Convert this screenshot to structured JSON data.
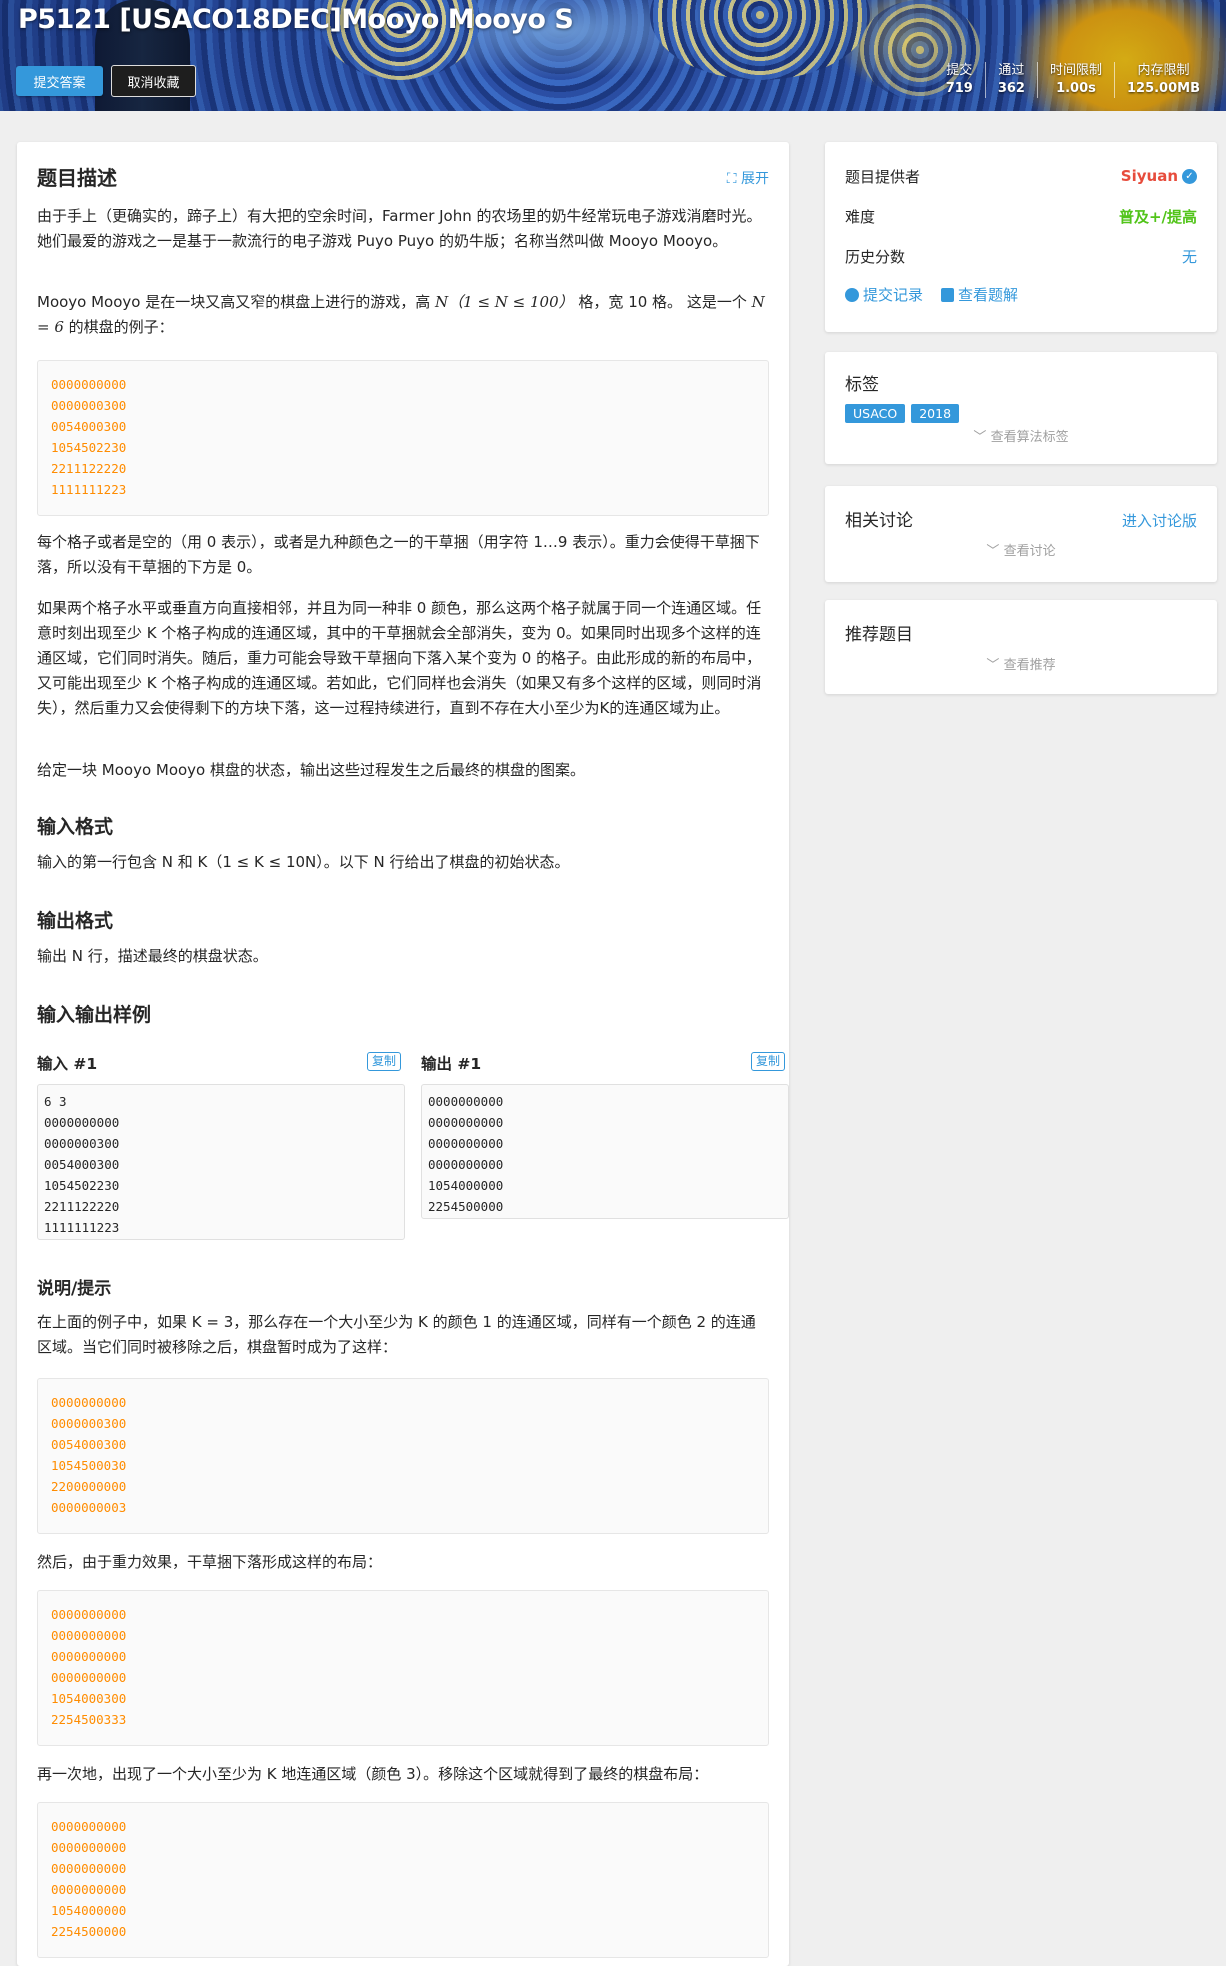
{
  "header": {
    "title": "P5121 [USACO18DEC]Mooyo Mooyo S",
    "submit_label": "提交答案",
    "unfav_label": "取消收藏",
    "stats": [
      {
        "label": "提交",
        "value": "719"
      },
      {
        "label": "通过",
        "value": "362"
      },
      {
        "label": "时间限制",
        "value": "1.00s"
      },
      {
        "label": "内存限制",
        "value": "125.00MB"
      }
    ]
  },
  "main": {
    "desc_title": "题目描述",
    "expand_label": "展开",
    "p1": "由于手上（更确实的，蹄子上）有大把的空余时间，Farmer John 的农场里的奶牛经常玩电子游戏消磨时光。她们最爱的游戏之一是基于一款流行的电子游戏 Puyo Puyo 的奶牛版；名称当然叫做 Mooyo Mooyo。",
    "p2a": "Mooyo Mooyo 是在一块又高又窄的棋盘上进行的游戏，高 ",
    "p2b": "N（1 ≤ N ≤ 100）",
    "p2c": " 格，宽 10 格。 这是一个 ",
    "p2d": "N = 6",
    "p2e": " 的棋盘的例子：",
    "board1": [
      "0000000000",
      "0000000300",
      "0054000300",
      "1054502230",
      "2211122220",
      "1111111223"
    ],
    "p3": "每个格子或者是空的（用 0 表示），或者是九种颜色之一的干草捆（用字符 1…9 表示）。重力会使得干草捆下落，所以没有干草捆的下方是 0。",
    "p4": "如果两个格子水平或垂直方向直接相邻，并且为同一种非 0 颜色，那么这两个格子就属于同一个连通区域。任意时刻出现至少 K 个格子构成的连通区域，其中的干草捆就会全部消失，变为 0。如果同时出现多个这样的连通区域，它们同时消失。随后，重力可能会导致干草捆向下落入某个变为 0 的格子。由此形成的新的布局中，又可能出现至少 K 个格子构成的连通区域。若如此，它们同样也会消失（如果又有多个这样的区域，则同时消失），然后重力又会使得剩下的方块下落，这一过程持续进行，直到不存在大小至少为K的连通区域为止。",
    "p5": "给定一块 Mooyo Mooyo 棋盘的状态，输出这些过程发生之后最终的棋盘的图案。",
    "input_title": "输入格式",
    "input_text": "输入的第一行包含 N 和 K（1 ≤ K ≤ 10N）。以下 N 行给出了棋盘的初始状态。",
    "output_title": "输出格式",
    "output_text": "输出 N 行，描述最终的棋盘状态。",
    "samples_title": "输入输出样例",
    "input_label": "输入 #1",
    "output_label": "输出 #1",
    "copy_label": "复制",
    "sample_input": [
      "6 3",
      "0000000000",
      "0000000300",
      "0054000300",
      "1054502230",
      "2211122220",
      "1111111223"
    ],
    "sample_output": [
      "0000000000",
      "0000000000",
      "0000000000",
      "0000000000",
      "1054000000",
      "2254500000"
    ],
    "hint_title": "说明/提示",
    "hint_p1": "在上面的例子中，如果 K = 3，那么存在一个大小至少为 K 的颜色 1 的连通区域，同样有一个颜色 2 的连通区域。当它们同时被移除之后，棋盘暂时成为了这样：",
    "board2": [
      "0000000000",
      "0000000300",
      "0054000300",
      "1054500030",
      "2200000000",
      "0000000003"
    ],
    "hint_p2": "然后，由于重力效果，干草捆下落形成这样的布局：",
    "board3": [
      "0000000000",
      "0000000000",
      "0000000000",
      "0000000000",
      "1054000300",
      "2254500333"
    ],
    "hint_p3": "再一次地，出现了一个大小至少为 K 地连通区域（颜色 3）。移除这个区域就得到了最终的棋盘布局：",
    "board4": [
      "0000000000",
      "0000000000",
      "0000000000",
      "0000000000",
      "1054000000",
      "2254500000"
    ]
  },
  "sidebar": {
    "provider_label": "题目提供者",
    "provider": "Siyuan",
    "difficulty_label": "难度",
    "difficulty": "普及+/提高",
    "history_label": "历史分数",
    "history": "无",
    "submissions_link": "提交记录",
    "solutions_link": "查看题解",
    "tags_title": "标签",
    "tags": [
      "USACO",
      "2018"
    ],
    "tags_more": "查看算法标签",
    "discuss_title": "相关讨论",
    "discuss_link": "进入讨论版",
    "discuss_more": "查看讨论",
    "recommend_title": "推荐题目",
    "recommend_more": "查看推荐"
  },
  "colors": {
    "accent": "#3498db",
    "code": "#ff8c00",
    "provider": "#e74c3c",
    "difficulty": "#52c41a"
  }
}
